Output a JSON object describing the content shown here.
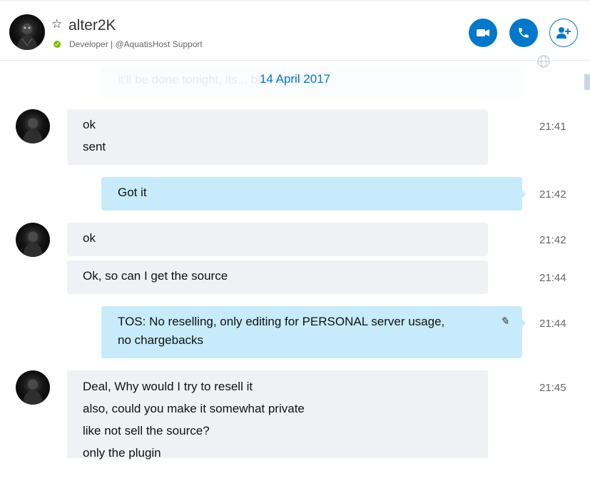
{
  "header": {
    "contact_name": "alter2K",
    "subtitle": "Developer | @AquatisHost Support",
    "icons": {
      "favorite": "star-outline-icon",
      "status": "online-check-icon",
      "video": "video-call-icon",
      "call": "phone-icon",
      "add": "add-people-icon",
      "globe": "globe-icon"
    }
  },
  "conversation": {
    "faded_message": "it'll be done tonight, its... break rn lol",
    "date_separator": "14 April 2017",
    "messages": [
      {
        "sender": "contact",
        "lines": [
          "ok",
          "sent"
        ],
        "time": "21:41"
      },
      {
        "sender": "me",
        "lines": [
          "Got it"
        ],
        "time": "21:42"
      },
      {
        "sender": "contact",
        "lines": [
          "ok"
        ],
        "time": "21:42"
      },
      {
        "sender": "contact",
        "lines": [
          "Ok, so can I get the source"
        ],
        "time": "21:44"
      },
      {
        "sender": "me",
        "lines": [
          "TOS:  No reselling, only editing for PERSONAL server usage,",
          "no chargebacks"
        ],
        "time": "21:44",
        "edited": true
      },
      {
        "sender": "contact",
        "lines": [
          "Deal, Why would I try to resell it",
          "also, could you make it somewhat private",
          "like not sell the source?",
          "only the plugin"
        ],
        "time": "21:45"
      }
    ]
  },
  "colors": {
    "accent": "#0078ca",
    "incoming_bubble": "#f0f1f5",
    "outgoing_bubble": "#c7ebfa",
    "online": "#7fba00"
  }
}
